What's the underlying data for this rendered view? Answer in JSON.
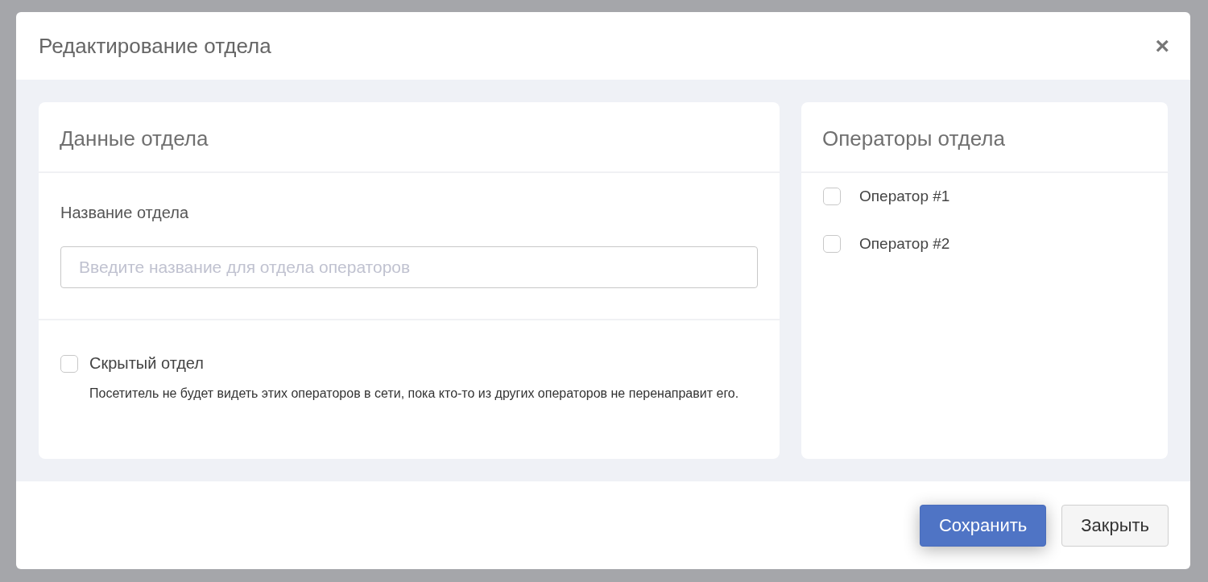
{
  "dialog": {
    "title": "Редактирование отдела",
    "close": "×"
  },
  "department": {
    "title": "Данные отдела",
    "name_label": "Название отдела",
    "name_field": {
      "placeholder": "Введите название для отдела операторов"
    },
    "hidden": {
      "label": "Скрытый отдел",
      "checked": false,
      "hint": "Посетитель не будет видеть этих операторов в сети, пока кто-то из других операторов не перенаправит его."
    }
  },
  "operators": {
    "title": "Операторы отдела",
    "items": [
      {
        "label": "Оператор #1",
        "checked": false
      },
      {
        "label": "Оператор #2",
        "checked": false
      }
    ]
  },
  "buttons": [
    {
      "label": "Сохранить",
      "kind": "primary"
    },
    {
      "label": "Закрыть",
      "kind": "default"
    }
  ]
}
